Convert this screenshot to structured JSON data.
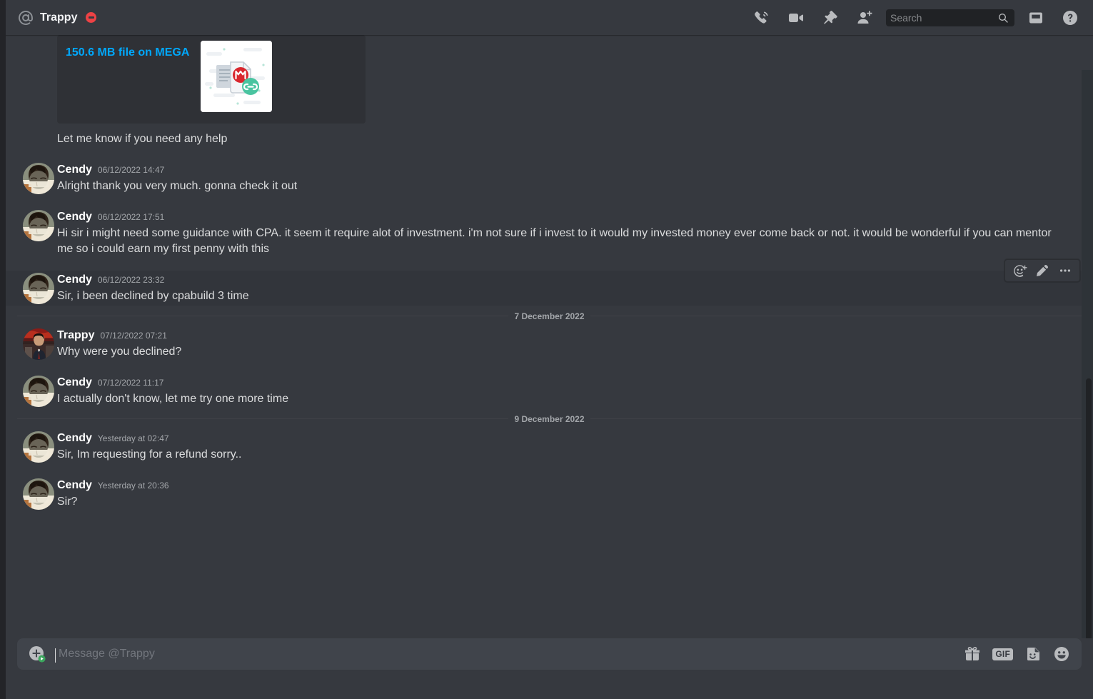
{
  "header": {
    "at_icon": "at-icon",
    "title": "Trappy",
    "status": "dnd",
    "buttons": [
      {
        "name": "start-voice-call-button",
        "icon": "phone-call-icon"
      },
      {
        "name": "start-video-call-button",
        "icon": "video-camera-icon"
      },
      {
        "name": "pinned-messages-button",
        "icon": "pin-icon"
      },
      {
        "name": "add-friends-to-dm-button",
        "icon": "person-add-icon"
      }
    ],
    "search": {
      "placeholder": "Search",
      "value": "",
      "icon": "search-icon"
    },
    "inbox": {
      "label": "Inbox",
      "icon": "inbox-icon"
    },
    "help": {
      "label": "Help",
      "icon": "help-circle-icon"
    }
  },
  "colors": {
    "accent_link": "#00a8fc",
    "status_dnd": "#ed4245",
    "chat_bg": "#36393f",
    "embed_bg": "#2f3136",
    "input_bg": "#40444b",
    "hover_bg": "#32353b"
  },
  "messages": [
    {
      "id": "m0",
      "type": "embed-continuation",
      "embed": {
        "title": "150.6 MB file on MEGA",
        "thumb": "mega-file-link-thumbnail"
      },
      "text": "Let me know if you need any help"
    },
    {
      "id": "m1",
      "author": "Cendy",
      "avatar": "cendy-avatar",
      "timestamp": "06/12/2022 14:47",
      "text": "Alright thank you very much. gonna check it out"
    },
    {
      "id": "m2",
      "author": "Cendy",
      "avatar": "cendy-avatar",
      "timestamp": "06/12/2022 17:51",
      "text": "Hi sir i might need some guidance with CPA. it seem it require alot of investment. i'm not sure if i invest to it would my invested money ever come back or not. it would be wonderful if you can mentor me so i could earn my first penny with this"
    },
    {
      "id": "m3",
      "author": "Cendy",
      "avatar": "cendy-avatar",
      "timestamp": "06/12/2022 23:32",
      "text": "Sir, i been declined by cpabuild 3 time",
      "hovered": true,
      "toolbar": [
        {
          "name": "add-reaction-button",
          "icon": "add-reaction-icon"
        },
        {
          "name": "edit-message-button",
          "icon": "pencil-icon"
        },
        {
          "name": "more-actions-button",
          "icon": "ellipsis-icon"
        }
      ]
    },
    {
      "id": "d1",
      "type": "date-divider",
      "label": "7 December 2022"
    },
    {
      "id": "m4",
      "author": "Trappy",
      "avatar": "trappy-avatar",
      "timestamp": "07/12/2022 07:21",
      "text": "Why were you declined?"
    },
    {
      "id": "m5",
      "author": "Cendy",
      "avatar": "cendy-avatar",
      "timestamp": "07/12/2022 11:17",
      "text": "I actually don't know, let me try one more time"
    },
    {
      "id": "d2",
      "type": "date-divider",
      "label": "9 December 2022"
    },
    {
      "id": "m6",
      "author": "Cendy",
      "avatar": "cendy-avatar",
      "timestamp": "Yesterday at 02:47",
      "text": "Sir, Im requesting for a refund sorry.."
    },
    {
      "id": "m7",
      "author": "Cendy",
      "avatar": "cendy-avatar",
      "timestamp": "Yesterday at 20:36",
      "text": "Sir?"
    }
  ],
  "composer": {
    "placeholder": "Message @Trappy",
    "value": "",
    "attach": {
      "name": "attach-file-button",
      "icon": "plus-circle-icon"
    },
    "icons": [
      {
        "name": "gift-button",
        "icon": "gift-icon",
        "label": ""
      },
      {
        "name": "gif-picker-button",
        "icon": "gif-icon",
        "label": "GIF"
      },
      {
        "name": "sticker-picker-button",
        "icon": "sticker-icon",
        "label": ""
      },
      {
        "name": "emoji-picker-button",
        "icon": "emoji-icon",
        "label": ""
      }
    ]
  }
}
